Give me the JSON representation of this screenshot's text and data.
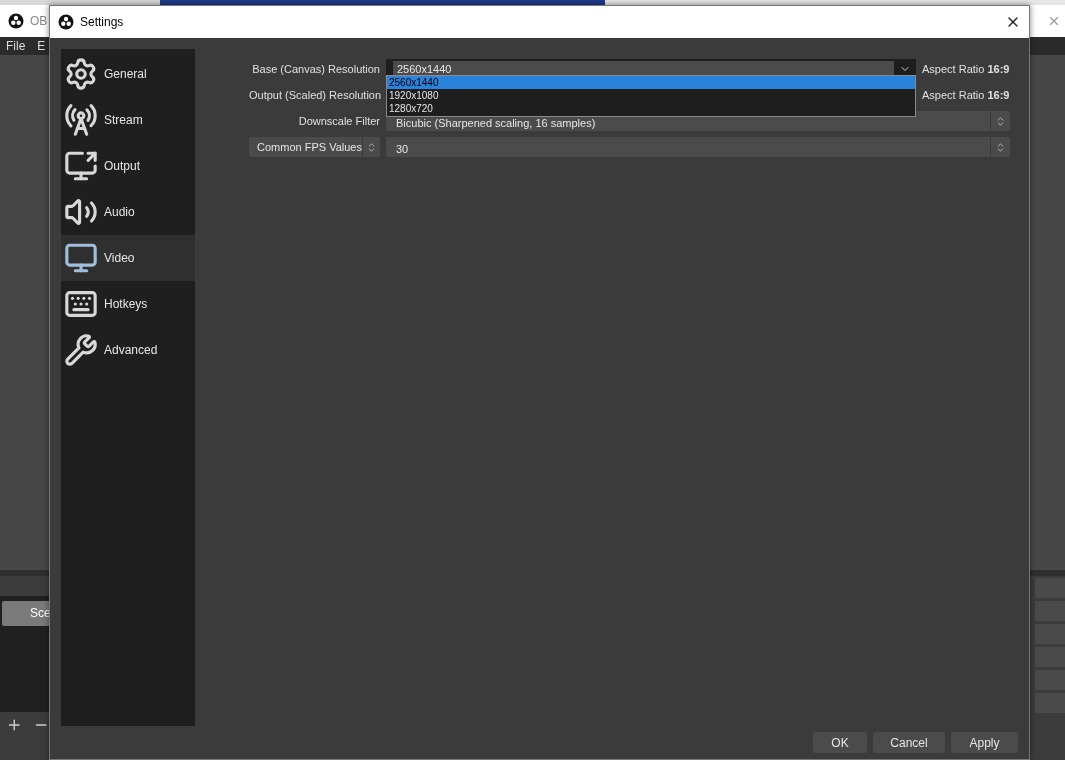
{
  "background_window": {
    "title": "OB",
    "menu": [
      "File",
      "E"
    ],
    "scene_button": "Sce"
  },
  "dialog": {
    "title": "Settings"
  },
  "sidebar": [
    {
      "label": "General",
      "selected": false
    },
    {
      "label": "Stream",
      "selected": false
    },
    {
      "label": "Output",
      "selected": false
    },
    {
      "label": "Audio",
      "selected": false
    },
    {
      "label": "Video",
      "selected": true
    },
    {
      "label": "Hotkeys",
      "selected": false
    },
    {
      "label": "Advanced",
      "selected": false
    }
  ],
  "video_rows": [
    {
      "kind": "combo",
      "label": "Base (Canvas) Resolution",
      "value": "2560x1440",
      "aspect": "Aspect Ratio **16:9**"
    },
    {
      "kind": "combo",
      "label": "Output (Scaled) Resolution",
      "aspect": "Aspect Ratio **16:9**"
    },
    {
      "kind": "spin",
      "label": "Downscale Filter",
      "value": "Bicubic (Sharpened scaling, 16 samples)"
    },
    {
      "kind": "fps",
      "button": "Common FPS Values",
      "value": "30"
    }
  ],
  "dropdown": {
    "options": [
      {
        "label": "2560x1440",
        "selected": true
      },
      {
        "label": "1920x1080",
        "selected": false
      },
      {
        "label": "1280x720",
        "selected": false
      }
    ]
  },
  "buttons": [
    "OK",
    "Cancel",
    "Apply"
  ]
}
